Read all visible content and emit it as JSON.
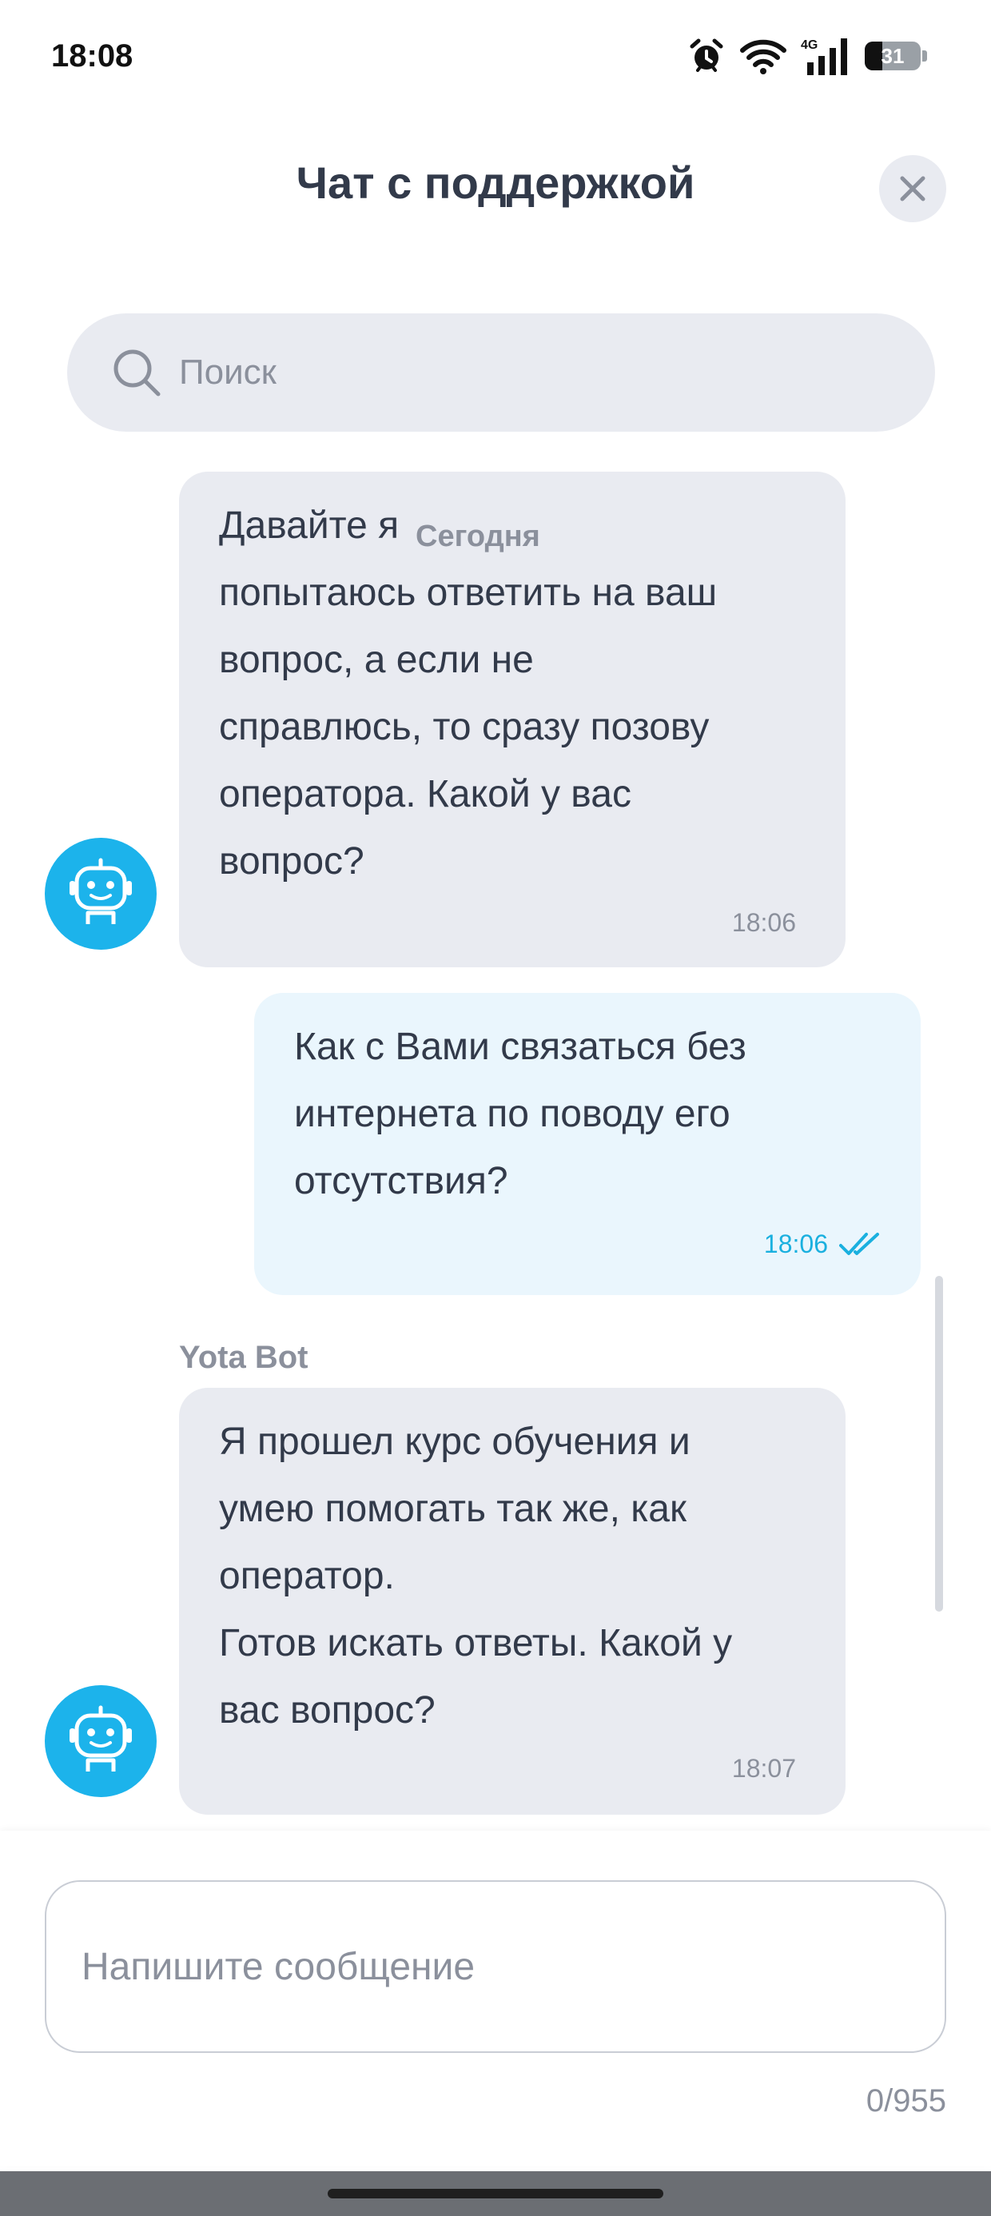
{
  "status_bar": {
    "time": "18:08",
    "icons": [
      "alarm-icon",
      "wifi-icon",
      "4g-signal-icon",
      "battery-icon"
    ],
    "network": "4G",
    "battery_level": "31"
  },
  "header": {
    "title": "Чат с поддержкой",
    "close_icon": "close-icon"
  },
  "search": {
    "placeholder": "Поиск",
    "value": ""
  },
  "chat": {
    "date_separator": "Сегодня",
    "messages": [
      {
        "from": "bot",
        "text": "Давайте я\nпопытаюсь ответить на ваш\nвопрос, а если не\nсправлюсь, то сразу позову\nоператора. Какой у вас\nвопрос?",
        "time": "18:06"
      },
      {
        "from": "user",
        "text": "Как с Вами связаться без\nинтернета по поводу его\nотсутствия?",
        "time": "18:06",
        "status": "read"
      },
      {
        "from": "bot",
        "sender": "Yota Bot",
        "text": "Я прошел курс обучения и\nумею помогать так же, как\nоператор.\nГотов искать ответы. Какой у\nвас вопрос?",
        "time": "18:07"
      }
    ]
  },
  "composer": {
    "placeholder": "Напишите сообщение",
    "value": "",
    "counter": "0/955"
  },
  "colors": {
    "accent": "#1cb3eb",
    "bot_bubble": "#e9ebf1",
    "user_bubble": "#eaf6fd",
    "text": "#323a4a",
    "muted": "#8b909c"
  }
}
